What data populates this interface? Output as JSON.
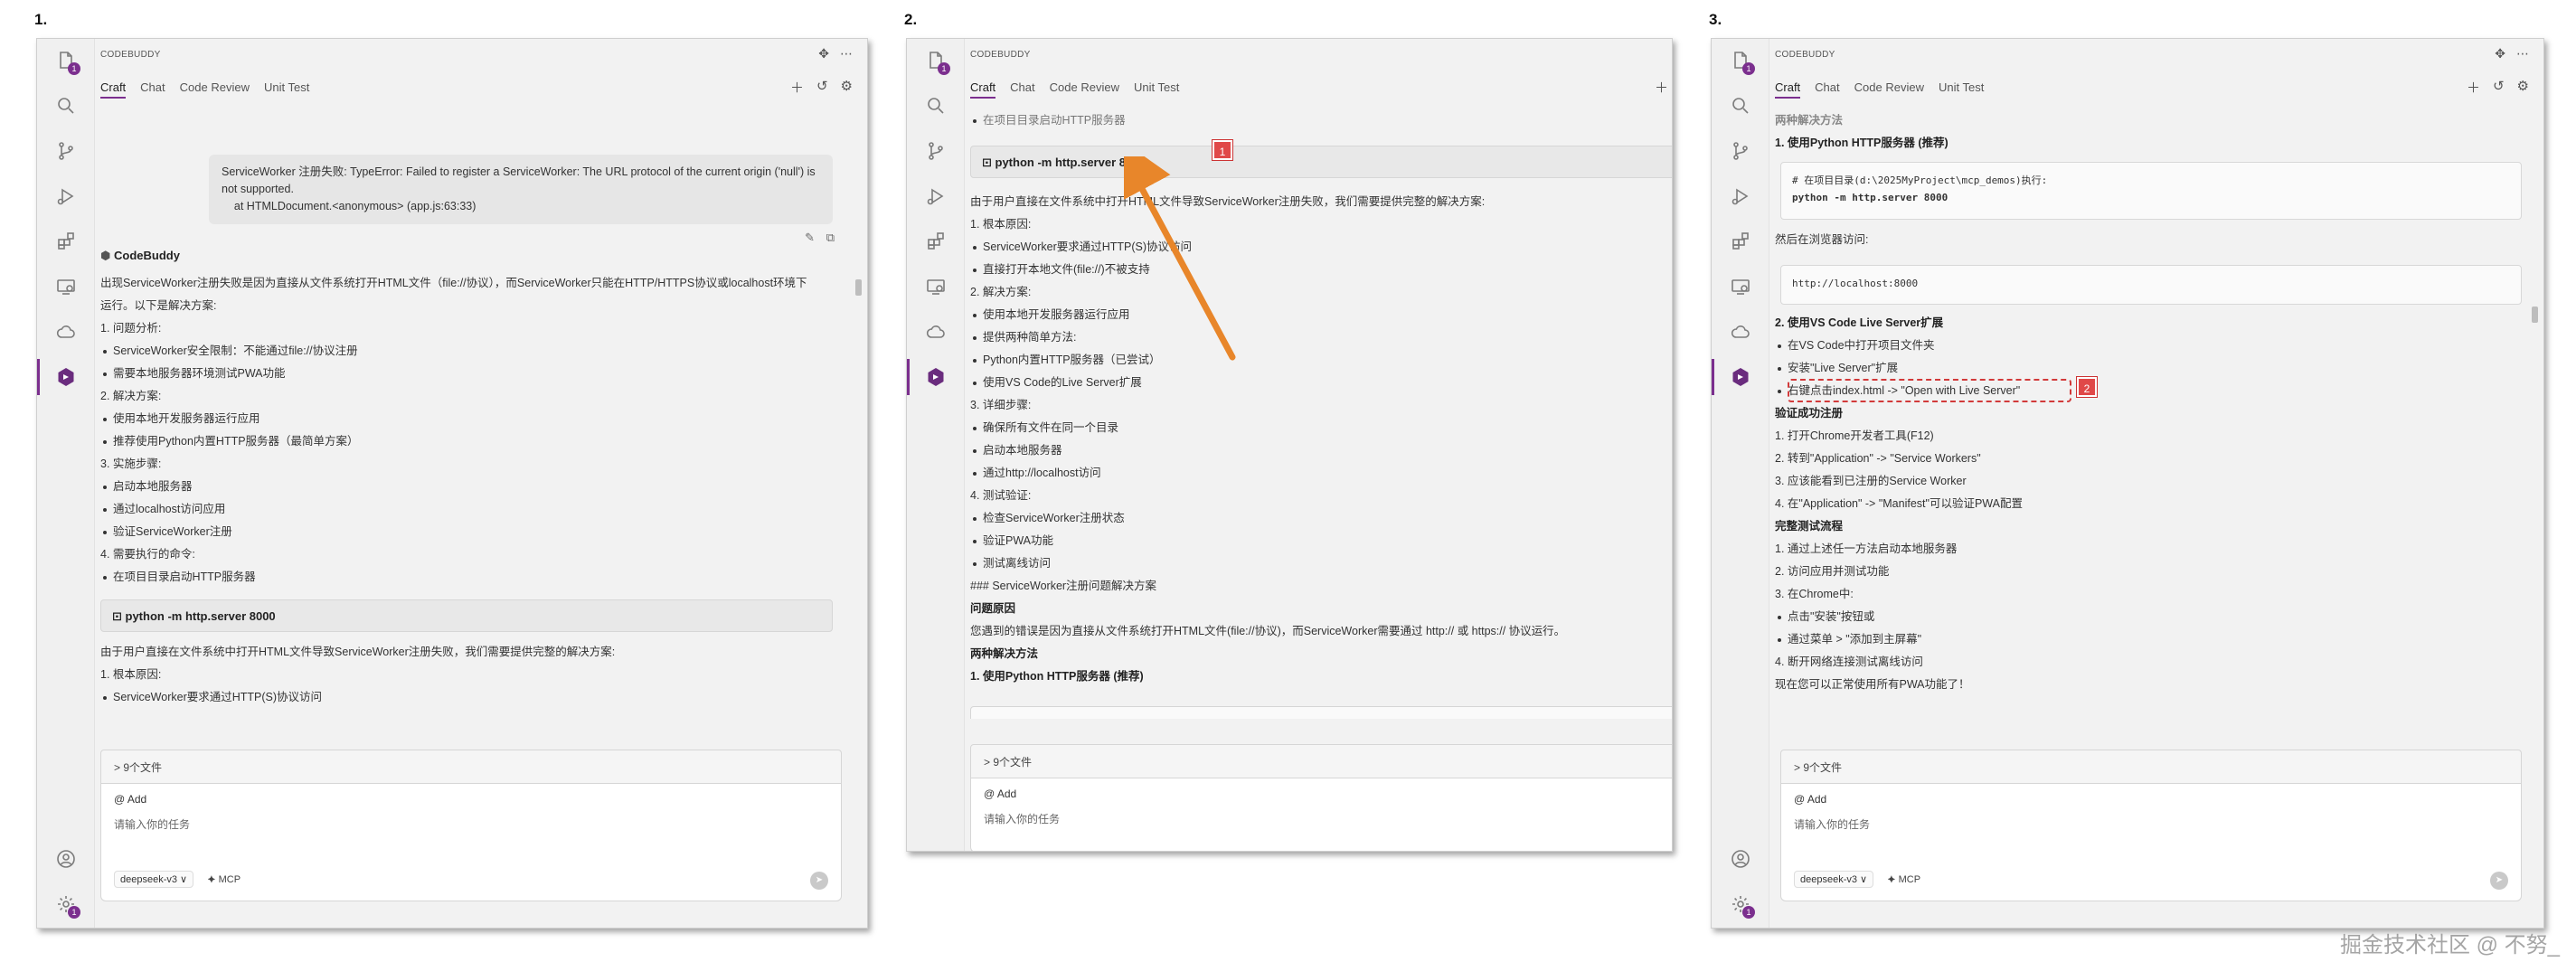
{
  "step_labels": [
    "1.",
    "2.",
    "3."
  ],
  "app": {
    "brand": "CODEBUDDY",
    "tabs": [
      "Craft",
      "Chat",
      "Code Review",
      "Unit Test"
    ],
    "icons": [
      "files-icon",
      "search-icon",
      "source-control-icon",
      "run-debug-icon",
      "extensions-icon",
      "remote-icon",
      "cloud-icon",
      "codebuddy-icon",
      "account-icon",
      "settings-icon"
    ],
    "top_right_icons": [
      "pin-icon",
      "more-icon"
    ],
    "tab_actions": [
      "new-chat-icon",
      "history-icon",
      "settings-icon"
    ],
    "badges": {
      "files": "1",
      "settings": "1"
    },
    "files_bar": "> 9个文件",
    "add_label": "@ Add",
    "input_placeholder": "请输入你的任务",
    "model": "deepseek-v3 ∨",
    "mcp": "⯌ MCP"
  },
  "panel1": {
    "user_message_lines": [
      "ServiceWorker 注册失败: TypeError: Failed to register a ServiceWorker: The URL protocol of the current origin ('null') is",
      "not supported.",
      "    at HTMLDocument.<anonymous> (app.js:63:33)"
    ],
    "assistant_name": "CodeBuddy",
    "intro_lines": [
      "出现ServiceWorker注册失败是因为直接从文件系统打开HTML文件（file://协议），而ServiceWorker只能在HTTP/HTTPS协议或localhost环境下",
      "运行。以下是解决方案:"
    ],
    "items": [
      {
        "t": "1. 问题分析:",
        "s": "plain"
      },
      {
        "t": "ServiceWorker安全限制：不能通过file://协议注册",
        "s": "bul"
      },
      {
        "t": "需要本地服务器环境测试PWA功能",
        "s": "bul"
      },
      {
        "t": "2. 解决方案:",
        "s": "plain"
      },
      {
        "t": "使用本地开发服务器运行应用",
        "s": "bul"
      },
      {
        "t": "推荐使用Python内置HTTP服务器（最简单方案）",
        "s": "bul"
      },
      {
        "t": "3. 实施步骤:",
        "s": "plain"
      },
      {
        "t": "启动本地服务器",
        "s": "bul"
      },
      {
        "t": "通过localhost访问应用",
        "s": "bul"
      },
      {
        "t": "验证ServiceWorker注册",
        "s": "bul"
      },
      {
        "t": "4. 需要执行的命令:",
        "s": "plain"
      },
      {
        "t": "在项目目录启动HTTP服务器",
        "s": "bul"
      }
    ],
    "command": "⊡ python -m http.server 8000",
    "after_items": [
      {
        "t": "由于用户直接在文件系统中打开HTML文件导致ServiceWorker注册失败，我们需要提供完整的解决方案:",
        "s": "plain"
      },
      {
        "t": "1. 根本原因:",
        "s": "plain"
      },
      {
        "t": "ServiceWorker要求通过HTTP(S)协议访问",
        "s": "bul"
      }
    ]
  },
  "panel2": {
    "top_partial": "在项目目录启动HTTP服务器",
    "command": "⊡ python -m http.server 8000",
    "callout": "1",
    "items": [
      {
        "t": "由于用户直接在文件系统中打开HTML文件导致ServiceWorker注册失败，我们需要提供完整的解决方案:",
        "s": "plain"
      },
      {
        "t": "1. 根本原因:",
        "s": "plain"
      },
      {
        "t": "ServiceWorker要求通过HTTP(S)协议访问",
        "s": "bul"
      },
      {
        "t": "直接打开本地文件(file://)不被支持",
        "s": "bul"
      },
      {
        "t": "2. 解决方案:",
        "s": "plain"
      },
      {
        "t": "使用本地开发服务器运行应用",
        "s": "bul"
      },
      {
        "t": "提供两种简单方法:",
        "s": "bul"
      },
      {
        "t": "Python内置HTTP服务器（已尝试）",
        "s": "bul"
      },
      {
        "t": "使用VS Code的Live Server扩展",
        "s": "bul"
      },
      {
        "t": "3. 详细步骤:",
        "s": "plain"
      },
      {
        "t": "确保所有文件在同一个目录",
        "s": "bul"
      },
      {
        "t": "启动本地服务器",
        "s": "bul"
      },
      {
        "t": "通过http://localhost访问",
        "s": "bul"
      },
      {
        "t": "4. 测试验证:",
        "s": "plain"
      },
      {
        "t": "检查ServiceWorker注册状态",
        "s": "bul"
      },
      {
        "t": "验证PWA功能",
        "s": "bul"
      },
      {
        "t": "测试离线访问",
        "s": "bul"
      },
      {
        "t": "### ServiceWorker注册问题解决方案",
        "s": "plain"
      },
      {
        "t": "问题原因",
        "s": "b"
      },
      {
        "t": "您遇到的错误是因为直接从文件系统打开HTML文件(file://协议)，而ServiceWorker需要通过 http:// 或 https:// 协议运行。",
        "s": "plain"
      },
      {
        "t": "两种解决方法",
        "s": "b"
      },
      {
        "t": "1. 使用Python HTTP服务器 (推荐)",
        "s": "b"
      }
    ]
  },
  "panel3": {
    "top_partial": "两种解决方法",
    "heading": "1. 使用Python HTTP服务器 (推荐)",
    "code1_lines": [
      "# 在项目目录(d:\\2025MyProject\\mcp_demos)执行:",
      "python -m http.server 8000"
    ],
    "then_text": "然后在浏览器访问:",
    "code2": "http://localhost:8000",
    "callout": "2",
    "items": [
      {
        "t": "2. 使用VS Code Live Server扩展",
        "s": "b"
      },
      {
        "t": "在VS Code中打开项目文件夹",
        "s": "bul"
      },
      {
        "t": "安装\"Live Server\"扩展",
        "s": "bul"
      },
      {
        "t": "右键点击index.html -> \"Open with Live Server\"",
        "s": "bul"
      },
      {
        "t": "验证成功注册",
        "s": "b"
      },
      {
        "t": "1. 打开Chrome开发者工具(F12)",
        "s": "plain"
      },
      {
        "t": "2. 转到\"Application\" -> \"Service Workers\"",
        "s": "plain"
      },
      {
        "t": "3. 应该能看到已注册的Service Worker",
        "s": "plain"
      },
      {
        "t": "4. 在\"Application\" -> \"Manifest\"可以验证PWA配置",
        "s": "plain"
      },
      {
        "t": "完整测试流程",
        "s": "b"
      },
      {
        "t": "1. 通过上述任一方法启动本地服务器",
        "s": "plain"
      },
      {
        "t": "2. 访问应用并测试功能",
        "s": "plain"
      },
      {
        "t": "3. 在Chrome中:",
        "s": "plain"
      },
      {
        "t": "点击\"安装\"按钮或",
        "s": "bul"
      },
      {
        "t": "通过菜单 > \"添加到主屏幕\"",
        "s": "bul"
      },
      {
        "t": "4. 断开网络连接测试离线访问",
        "s": "plain"
      },
      {
        "t": "现在您可以正常使用所有PWA功能了！",
        "s": "plain"
      }
    ]
  },
  "watermark": "掘金技术社区 @ 不努_"
}
